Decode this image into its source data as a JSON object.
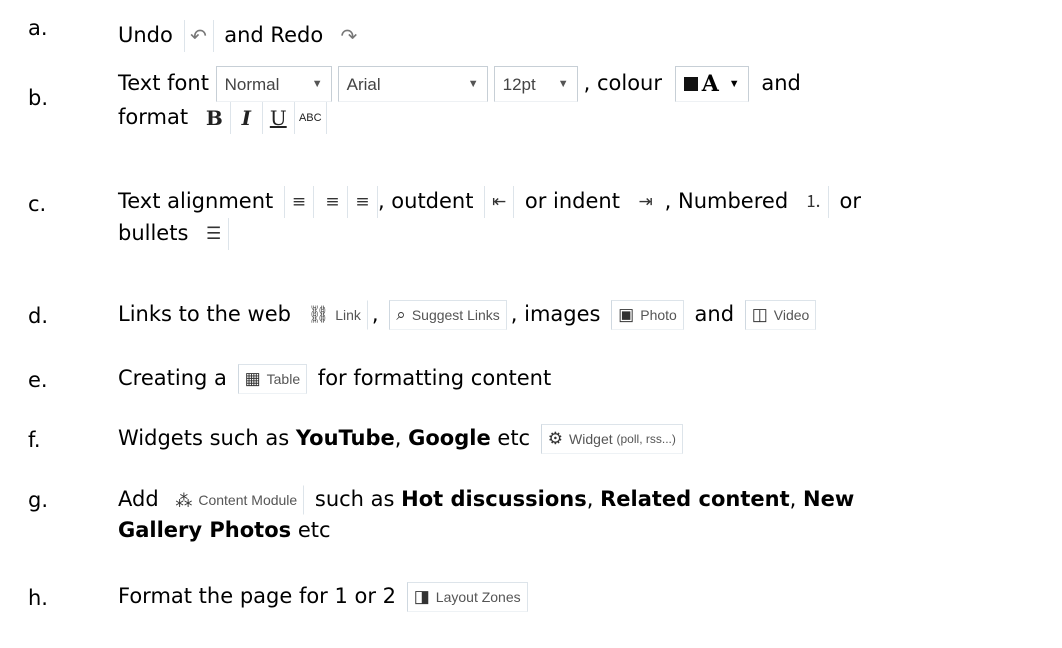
{
  "items": [
    {
      "marker": "a.",
      "pre": "Undo",
      "mid": "and Redo",
      "undo_icon": "undo-icon",
      "redo_icon": "redo-icon"
    },
    {
      "marker": "b.",
      "pre": "Text font",
      "selects": [
        "Normal",
        "Arial",
        "12pt"
      ],
      "after_selects": ", colour",
      "colour_glyph": "A",
      "after_colour": "and",
      "line2": "format",
      "format_buttons": [
        "B",
        "I",
        "U",
        "ABC"
      ]
    },
    {
      "marker": "c.",
      "pre": "Text alignment",
      "outdent": ", outdent",
      "indent": "or indent",
      "numbered": ", Numbered",
      "or": "or",
      "line2": "bullets"
    },
    {
      "marker": "d.",
      "pre": "Links to the web",
      "link_label": "Link",
      "suggest_label": "Suggest Links",
      "images": ", images",
      "photo_label": "Photo",
      "and": "and",
      "video_label": "Video"
    },
    {
      "marker": "e.",
      "pre": "Creating a",
      "table_label": "Table",
      "post": "for formatting content"
    },
    {
      "marker": "f.",
      "pre": "Widgets such as",
      "bold1": "YouTube",
      "sep": ",",
      "bold2": "Google",
      "post": "etc",
      "widget_label": "Widget",
      "widget_sub": "(poll, rss...)"
    },
    {
      "marker": "g.",
      "pre": "Add",
      "module_label": "Content Module",
      "mid": "such as",
      "bold1": "Hot discussions",
      "sep1": ",",
      "bold2": "Related content",
      "sep2": ",",
      "bold3": "New",
      "bold4": "Gallery Photos",
      "post": "etc"
    },
    {
      "marker": "h.",
      "pre": "Format the page for 1 or 2",
      "zones_label": "Layout Zones"
    }
  ]
}
